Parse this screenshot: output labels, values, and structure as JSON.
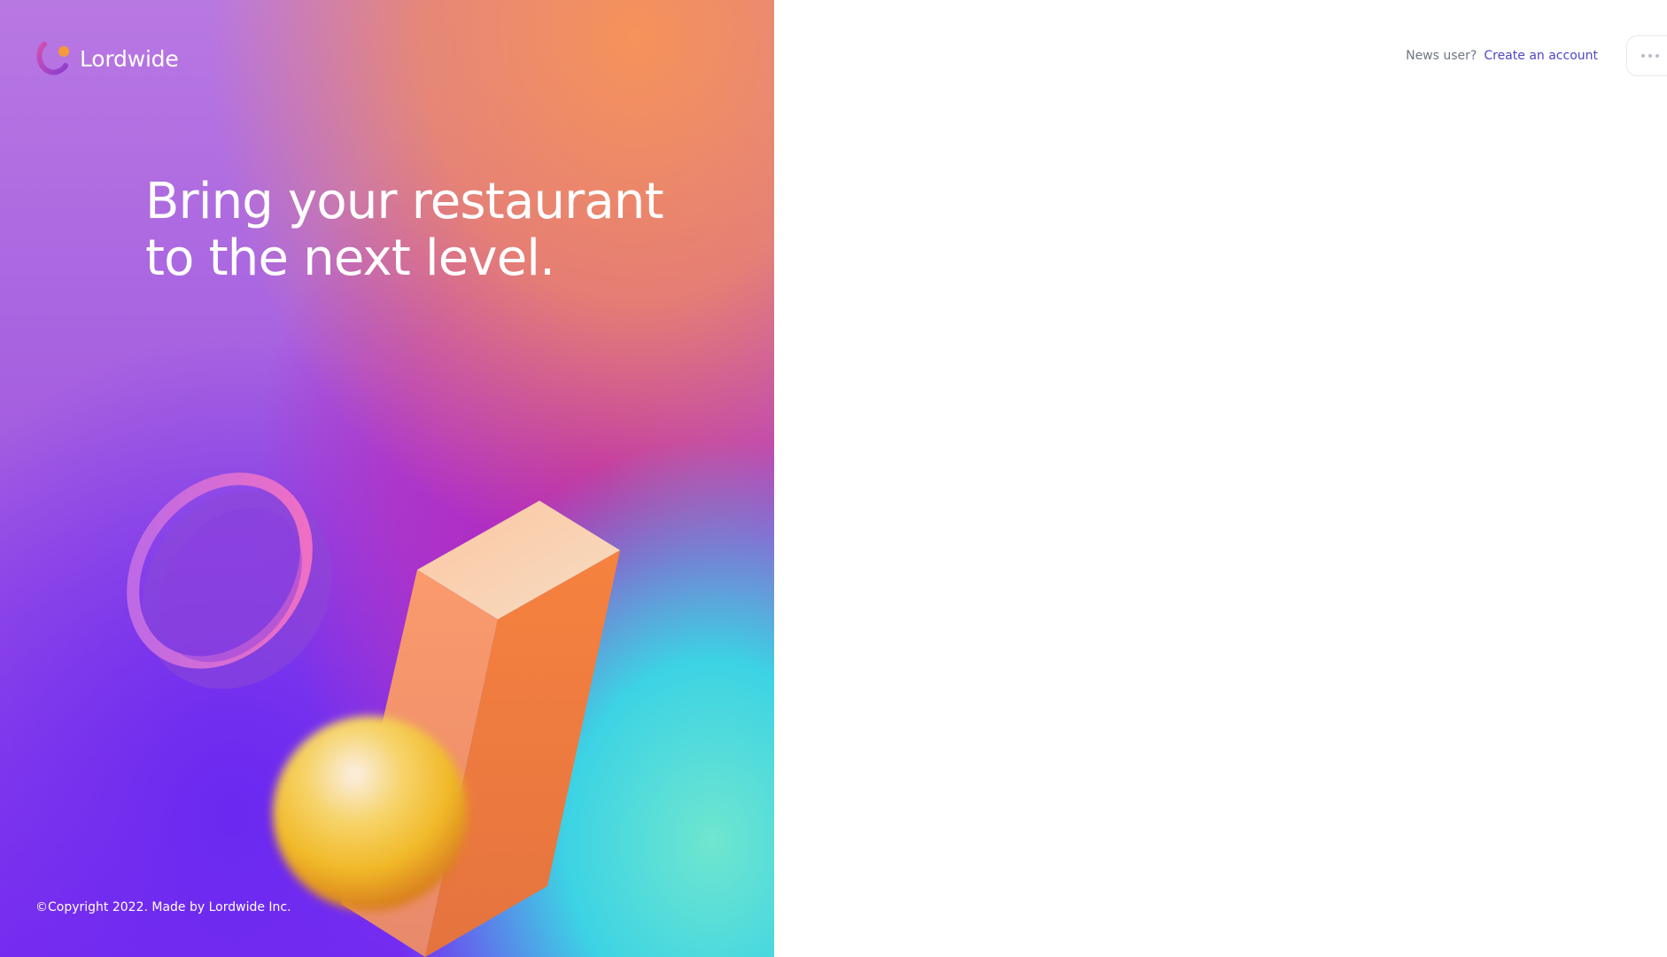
{
  "brand": {
    "name": "Lordwide",
    "logo_icon": "lordwide-logo-icon"
  },
  "hero": {
    "headline_line1": "Bring your restaurant",
    "headline_line2": "to the next level.",
    "copyright": "©Copyright 2022. Made by Lordwide Inc."
  },
  "topbar": {
    "prompt": "News user?",
    "signup_link": "Create an account",
    "more_icon": "more-horizontal-icon"
  },
  "colors": {
    "link": "#5146c4",
    "muted_text": "#6f7585",
    "hero_purple": "#9a3be0",
    "hero_orange": "#f08a5d",
    "hero_teal": "#3fd6d8"
  }
}
